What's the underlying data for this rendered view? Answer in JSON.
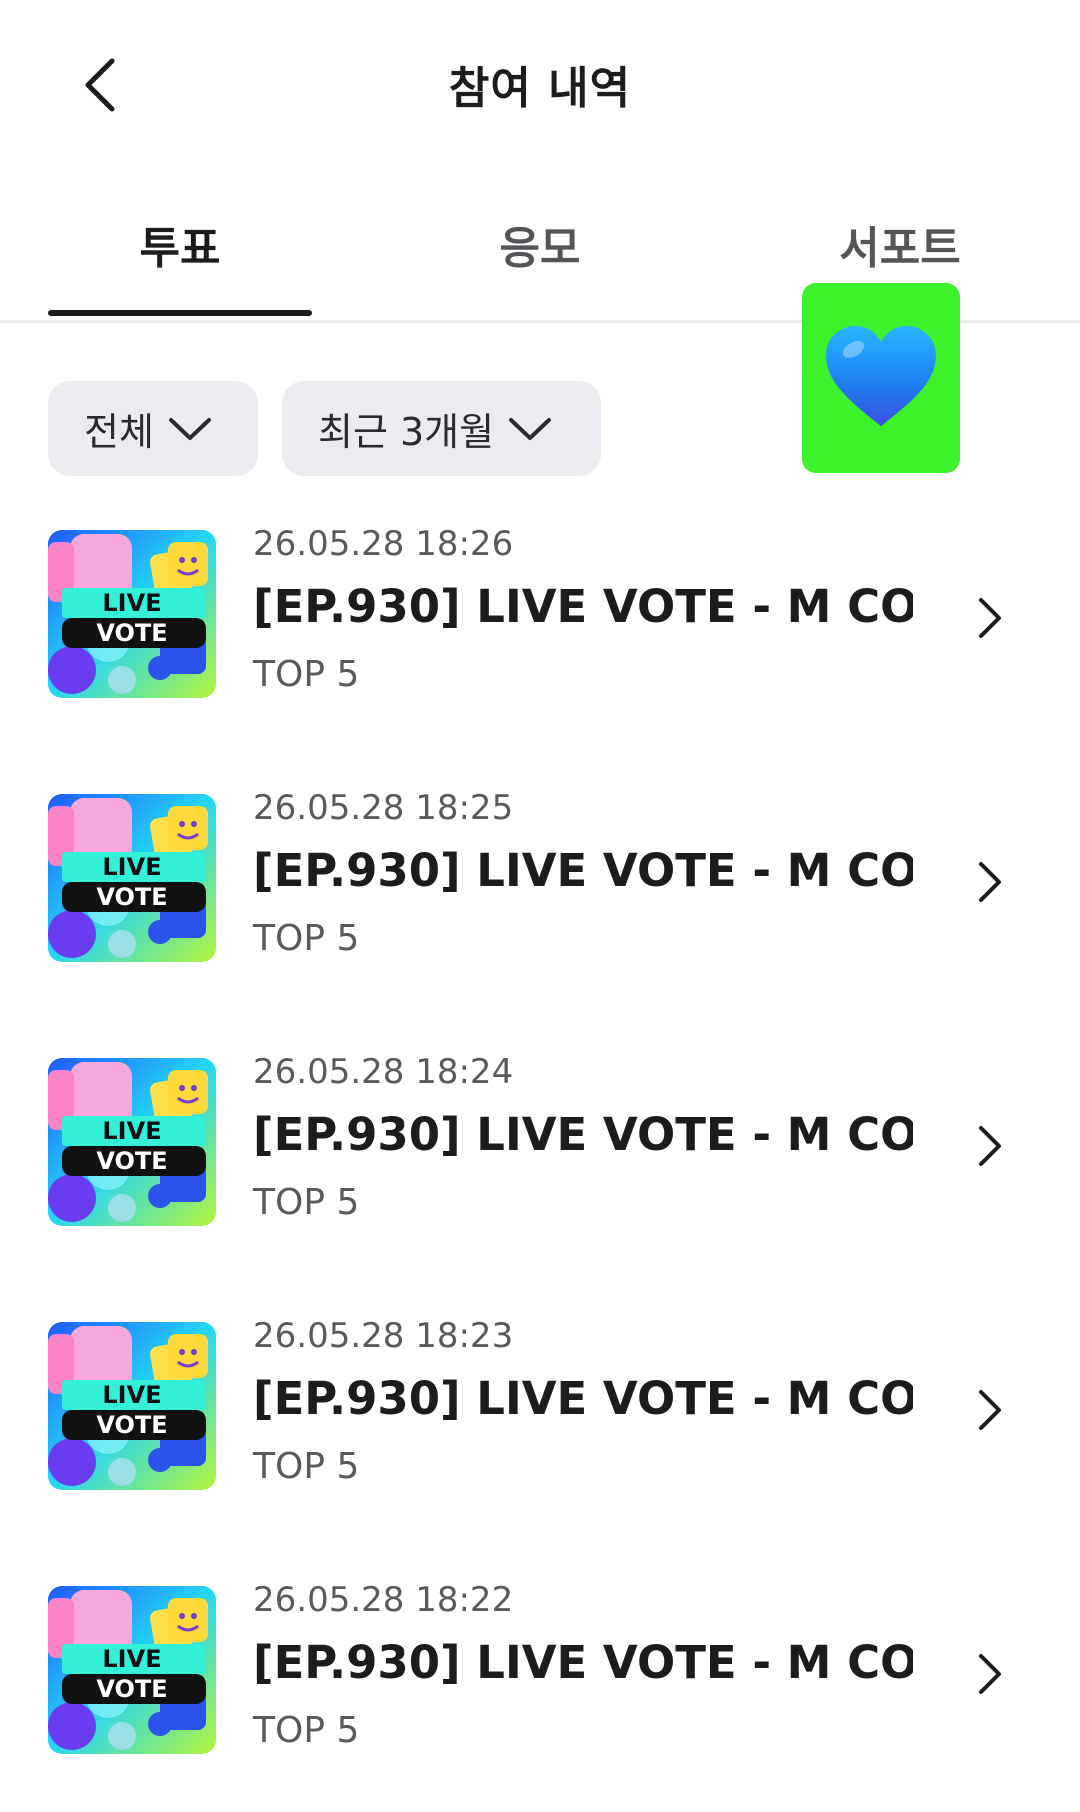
{
  "header": {
    "title": "참여 내역"
  },
  "tabs": [
    {
      "label": "투표",
      "active": true
    },
    {
      "label": "응모",
      "active": false
    },
    {
      "label": "서포트",
      "active": false
    }
  ],
  "badge": {
    "icon": "blue-heart-icon",
    "background": "#3df22a"
  },
  "filters": {
    "type": "전체",
    "period": "최근 3개월"
  },
  "items": [
    {
      "date": "26.05.28 18:26",
      "title": "[EP.930] LIVE VOTE - M CO...",
      "subtitle": "TOP 5",
      "thumb_text": [
        "LIVE",
        "VOTE"
      ]
    },
    {
      "date": "26.05.28 18:25",
      "title": "[EP.930] LIVE VOTE - M CO...",
      "subtitle": "TOP 5",
      "thumb_text": [
        "LIVE",
        "VOTE"
      ]
    },
    {
      "date": "26.05.28 18:24",
      "title": "[EP.930] LIVE VOTE - M CO...",
      "subtitle": "TOP 5",
      "thumb_text": [
        "LIVE",
        "VOTE"
      ]
    },
    {
      "date": "26.05.28 18:23",
      "title": "[EP.930] LIVE VOTE - M CO...",
      "subtitle": "TOP 5",
      "thumb_text": [
        "LIVE",
        "VOTE"
      ]
    },
    {
      "date": "26.05.28 18:22",
      "title": "[EP.930] LIVE VOTE - M CO...",
      "subtitle": "TOP 5",
      "thumb_text": [
        "LIVE",
        "VOTE"
      ]
    }
  ]
}
